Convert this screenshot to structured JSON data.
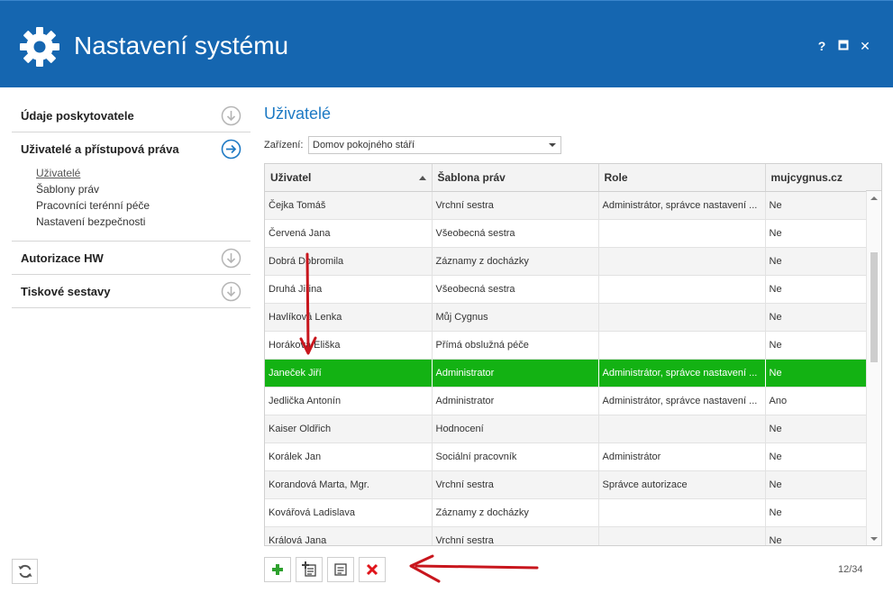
{
  "window": {
    "title": "Nastavení systému",
    "help_label": "?",
    "close_label": "✕"
  },
  "sidebar": {
    "sections": [
      {
        "label": "Údaje poskytovatele",
        "expanded": false
      },
      {
        "label": "Uživatelé a přístupová práva",
        "expanded": true,
        "items": [
          "Uživatelé",
          "Šablony práv",
          "Pracovníci terénní péče",
          "Nastavení bezpečnosti"
        ],
        "active_item": "Uživatelé"
      },
      {
        "label": "Autorizace HW",
        "expanded": false
      },
      {
        "label": "Tiskové sestavy",
        "expanded": false
      }
    ]
  },
  "main": {
    "title": "Uživatelé",
    "device_label": "Zařízení:",
    "device_value": "Domov pokojného stáří",
    "columns": [
      "Uživatel",
      "Šablona práv",
      "Role",
      "mujcygnus.cz"
    ],
    "rows": [
      [
        "Čejka Tomáš",
        "Vrchní sestra",
        "Administrátor, správce nastavení ...",
        "Ne"
      ],
      [
        "Červená Jana",
        "Všeobecná sestra",
        "",
        "Ne"
      ],
      [
        "Dobrá Dobromila",
        "Záznamy z docházky",
        "",
        "Ne"
      ],
      [
        "Druhá Jiřina",
        "Všeobecná sestra",
        "",
        "Ne"
      ],
      [
        "Havlíková Lenka",
        "Můj Cygnus",
        "",
        "Ne"
      ],
      [
        "Horáková Eliška",
        "Přímá obslužná péče",
        "",
        "Ne"
      ],
      [
        "Janeček Jiří",
        "Administrator",
        "Administrátor, správce nastavení ...",
        "Ne"
      ],
      [
        "Jedlička Antonín",
        "Administrator",
        "Administrátor, správce nastavení ...",
        "Ano"
      ],
      [
        "Kaiser Oldřich",
        "Hodnocení",
        "",
        "Ne"
      ],
      [
        "Korálek Jan",
        "Sociální pracovník",
        "Administrátor",
        "Ne"
      ],
      [
        "Korandová Marta, Mgr.",
        "Vrchní sestra",
        "Správce autorizace",
        "Ne"
      ],
      [
        "Kovářová Ladislava",
        "Záznamy z docházky",
        "",
        "Ne"
      ],
      [
        "Králová Jana",
        "Vrchní sestra",
        "",
        "Ne"
      ]
    ],
    "selected_row": 6,
    "record_counter": "12/34"
  },
  "colors": {
    "titlebar": "#1566b0",
    "accent": "#1e7ac4",
    "selection": "#13b213",
    "annotation_arrow": "#c8161d"
  },
  "toolbar": {
    "buttons": [
      "add-icon",
      "add-from-template-icon",
      "edit-icon",
      "delete-icon"
    ]
  }
}
